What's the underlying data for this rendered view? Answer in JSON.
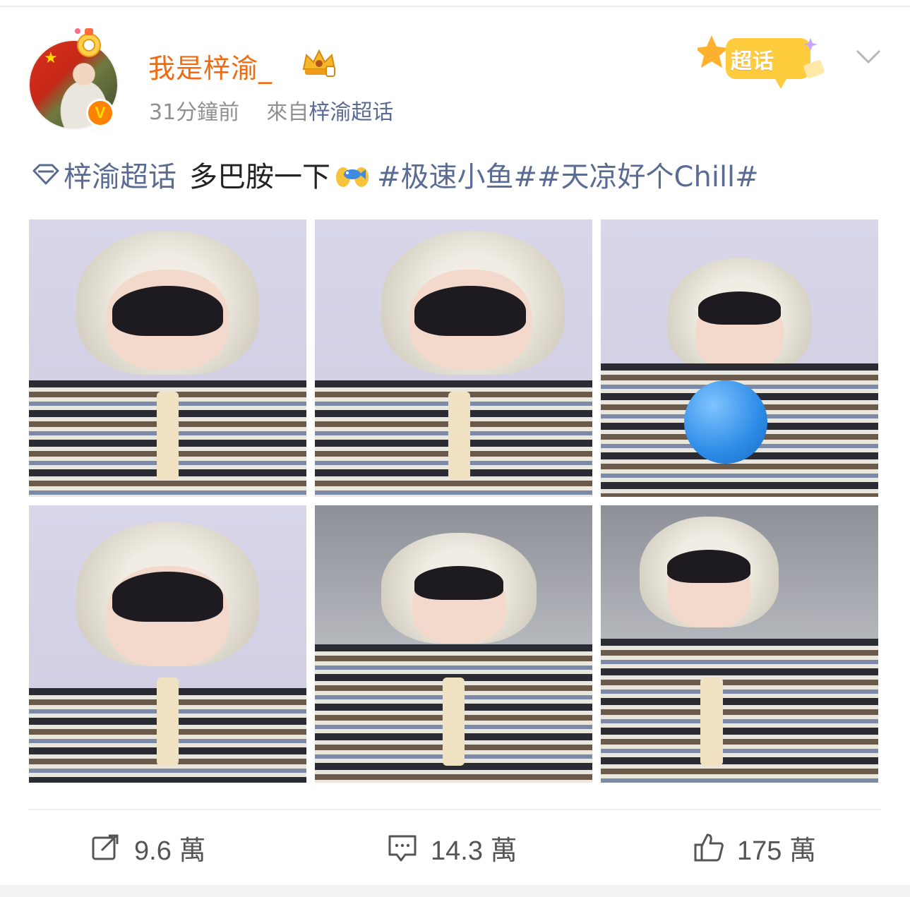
{
  "header": {
    "username": "我是梓渝_",
    "time_ago": "31分鐘前",
    "from_prefix": "來自",
    "source_link": "梓渝超话",
    "badge_label": "超话"
  },
  "post": {
    "topic_link": "梓渝超话",
    "text": "多巴胺一下",
    "hashtags": "#极速小鱼##天凉好个Chill#"
  },
  "photos": [
    {
      "id": "photo-1"
    },
    {
      "id": "photo-2"
    },
    {
      "id": "photo-3"
    },
    {
      "id": "photo-4"
    },
    {
      "id": "photo-5"
    },
    {
      "id": "photo-6"
    }
  ],
  "actions": {
    "repost_count": "9.6 萬",
    "comment_count": "14.3 萬",
    "like_count": "175 萬"
  },
  "icons": {
    "verified": "v-verified-icon",
    "crown": "crown-icon",
    "chevron": "chevron-down-icon",
    "topic": "diamond-icon",
    "repost": "repost-icon",
    "comment": "comment-icon",
    "like": "thumbs-up-icon"
  },
  "colors": {
    "username": "#f06b0f",
    "link": "#5a6b94",
    "meta": "#909090",
    "verified_badge": "#ff8200"
  }
}
